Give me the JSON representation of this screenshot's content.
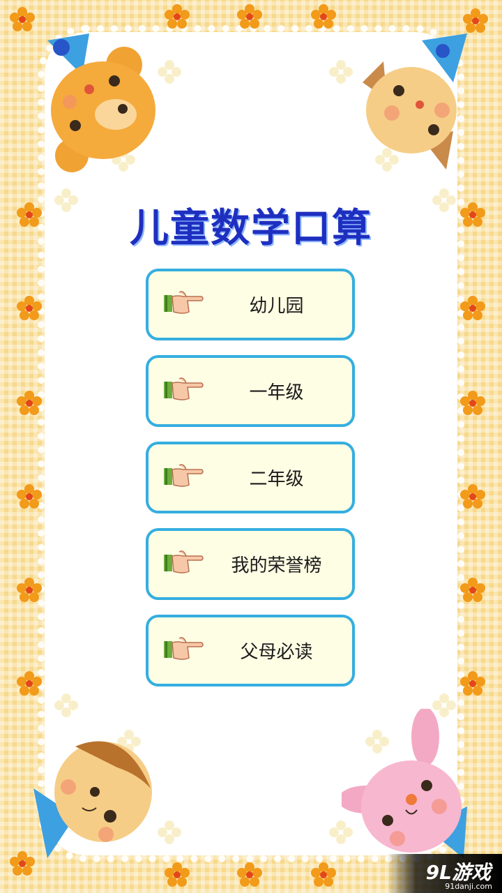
{
  "title": "儿童数学口算",
  "menu": [
    {
      "label": "幼儿园"
    },
    {
      "label": "一年级"
    },
    {
      "label": "二年级"
    },
    {
      "label": "我的荣誉榜"
    },
    {
      "label": "父母必读"
    }
  ],
  "watermark": {
    "logo": "9L游戏",
    "url": "91danji.com"
  },
  "icons": {
    "menu": "pointing-hand-icon"
  },
  "colors": {
    "title": "#1e2fc0",
    "button_border": "#35aee0",
    "button_fill": "#fefee4",
    "background": "#f7d98a"
  }
}
